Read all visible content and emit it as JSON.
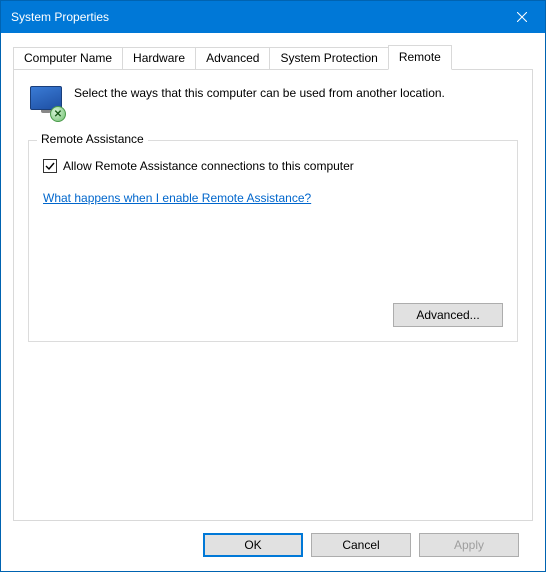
{
  "window": {
    "title": "System Properties"
  },
  "tabs": {
    "items": [
      {
        "label": "Computer Name"
      },
      {
        "label": "Hardware"
      },
      {
        "label": "Advanced"
      },
      {
        "label": "System Protection"
      },
      {
        "label": "Remote"
      }
    ],
    "active_index": 4
  },
  "intro": {
    "text": "Select the ways that this computer can be used from another location.",
    "icon_name": "remote-computer-icon"
  },
  "remote_assistance": {
    "group_title": "Remote Assistance",
    "checkbox_label": "Allow Remote Assistance connections to this computer",
    "checkbox_checked": true,
    "help_link": "What happens when I enable Remote Assistance?",
    "advanced_button": "Advanced..."
  },
  "buttons": {
    "ok": "OK",
    "cancel": "Cancel",
    "apply": "Apply",
    "apply_enabled": false
  }
}
